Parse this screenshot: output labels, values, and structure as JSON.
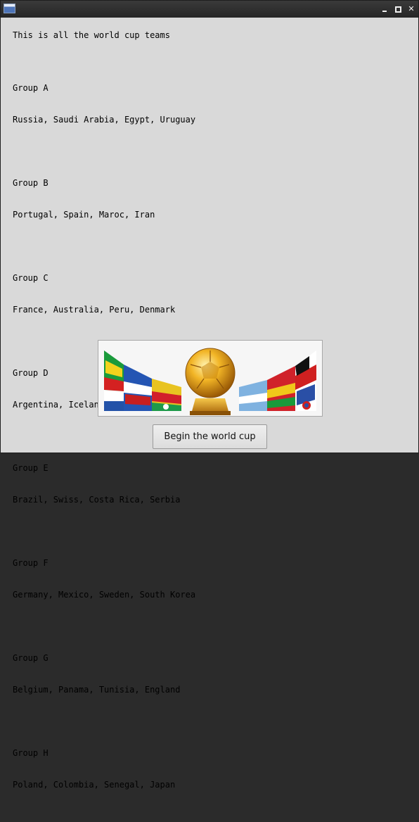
{
  "window": {
    "controls": [
      "minimize-icon",
      "maximize-icon",
      "close-icon"
    ]
  },
  "heading": "This is all the world cup teams",
  "groups": [
    {
      "name": "Group A",
      "teams": "Russia, Saudi Arabia, Egypt, Uruguay"
    },
    {
      "name": "Group B",
      "teams": "Portugal, Spain, Maroc, Iran"
    },
    {
      "name": "Group C",
      "teams": "France, Australia, Peru, Denmark"
    },
    {
      "name": "Group D",
      "teams": "Argentina, Iceland, Croatia, Nigeria"
    },
    {
      "name": "Group E",
      "teams": "Brazil, Swiss, Costa Rica, Serbia"
    },
    {
      "name": "Group F",
      "teams": "Germany, Mexico, Sweden, South Korea"
    },
    {
      "name": "Group G",
      "teams": "Belgium, Panama, Tunisia, England"
    },
    {
      "name": "Group H",
      "teams": "Poland, Colombia, Senegal, Japan"
    }
  ],
  "banner": {
    "icon": "world-cup-ball-flags-image"
  },
  "button": {
    "label": "Begin the world cup"
  }
}
